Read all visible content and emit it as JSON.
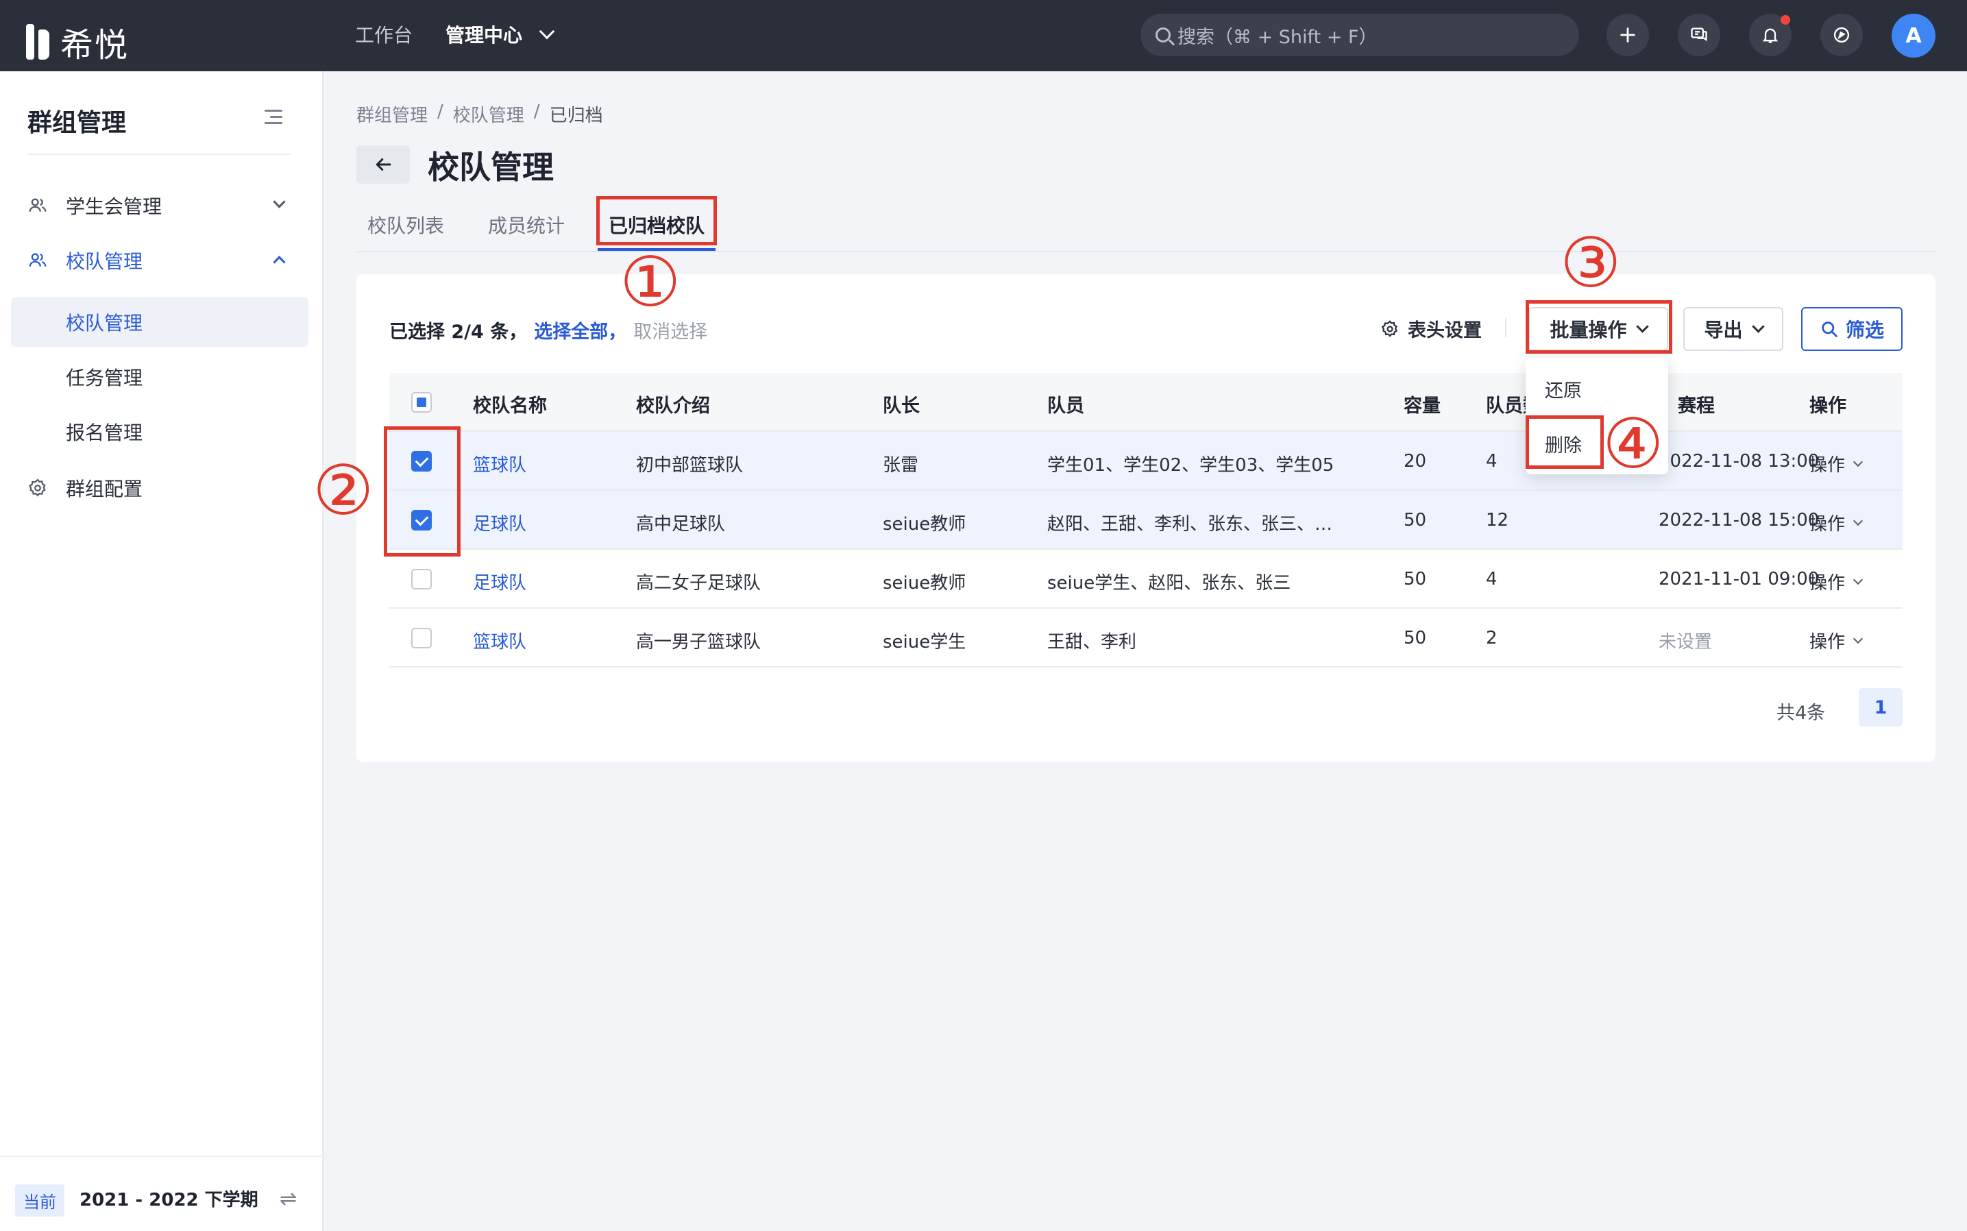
{
  "app": {
    "brand": "希悦"
  },
  "topnav": {
    "items": [
      "工作台",
      "管理中心"
    ]
  },
  "search": {
    "placeholder": "搜索（⌘ + Shift + F）"
  },
  "toolbar_icons": [
    "plus-icon",
    "chat-icon",
    "bell-icon",
    "compass-icon"
  ],
  "user": {
    "avatar_letter": "A"
  },
  "sidebar": {
    "title": "群组管理",
    "menu": [
      {
        "label": "学生会管理",
        "icon": "users-icon",
        "expanded": false
      },
      {
        "label": "校队管理",
        "icon": "users-icon",
        "expanded": true,
        "children": [
          "校队管理",
          "任务管理",
          "报名管理"
        ],
        "active_child": "校队管理"
      },
      {
        "label": "群组配置",
        "icon": "gear-icon"
      }
    ],
    "footer": {
      "tag": "当前",
      "term": "2021 - 2022 下学期"
    }
  },
  "breadcrumb": [
    "群组管理",
    "校队管理",
    "已归档"
  ],
  "page": {
    "title": "校队管理"
  },
  "tabs": [
    "校队列表",
    "成员统计",
    "已归档校队"
  ],
  "active_tab": "已归档校队",
  "selection": {
    "count_text": "已选择 2/4 条，",
    "select_all": "选择全部，",
    "cancel": "取消选择"
  },
  "actions": {
    "header_settings": "表头设置",
    "batch": "批量操作",
    "export": "导出",
    "filter": "筛选"
  },
  "batch_menu": [
    "还原",
    "删除"
  ],
  "table": {
    "columns": [
      "校队名称",
      "校队介绍",
      "队长",
      "队员",
      "容量",
      "队员数",
      "赛程",
      "操作"
    ],
    "rows": [
      {
        "name": "篮球队",
        "intro": "初中部篮球队",
        "captain": "张雷",
        "members": "学生01、学生02、学生03、学生05",
        "capacity": "20",
        "count": "4",
        "time": "2022-11-08 13:00",
        "op": "操作",
        "checked": true
      },
      {
        "name": "足球队",
        "intro": "高中足球队",
        "captain": "seiue教师",
        "members": "赵阳、王甜、李利、张东、张三、…",
        "capacity": "50",
        "count": "12",
        "time": "2022-11-08 15:00",
        "op": "操作",
        "checked": true
      },
      {
        "name": "足球队",
        "intro": "高二女子足球队",
        "captain": "seiue教师",
        "members": "seiue学生、赵阳、张东、张三",
        "capacity": "50",
        "count": "4",
        "time": "2021-11-01 09:00",
        "op": "操作",
        "checked": false
      },
      {
        "name": "篮球队",
        "intro": "高一男子篮球队",
        "captain": "seiue学生",
        "members": "王甜、李利",
        "capacity": "50",
        "count": "2",
        "time": "未设置",
        "op": "操作",
        "checked": false
      }
    ]
  },
  "pagination": {
    "total": "共4条",
    "current": "1"
  },
  "annotations": [
    "①",
    "②",
    "③",
    "④"
  ],
  "colors": {
    "accent": "#2a5bd7",
    "annotation": "#e03a2f",
    "topbar": "#2b2f3a"
  }
}
